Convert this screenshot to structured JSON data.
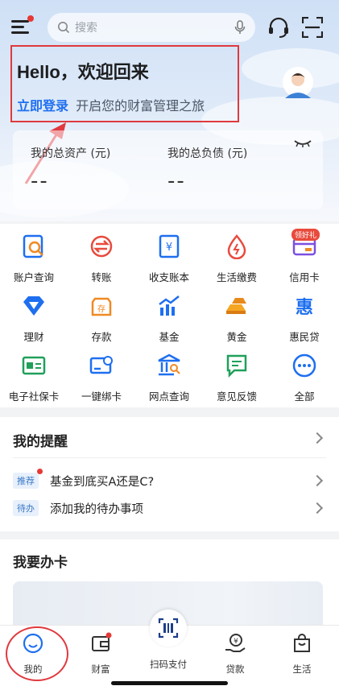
{
  "search": {
    "placeholder": "搜索"
  },
  "welcome": {
    "hello": "Hello，欢迎回来",
    "login_link": "立即登录",
    "login_sub": "开启您的财富管理之旅"
  },
  "assets": {
    "total_assets_label": "我的总资产 (元)",
    "total_assets_value": "--",
    "total_debt_label": "我的总负债 (元)",
    "total_debt_value": "--"
  },
  "grid": {
    "items": [
      {
        "label": "账户查询",
        "icon": "account-query-icon"
      },
      {
        "label": "转账",
        "icon": "transfer-icon"
      },
      {
        "label": "收支账本",
        "icon": "ledger-icon"
      },
      {
        "label": "生活缴费",
        "icon": "utility-payment-icon"
      },
      {
        "label": "信用卡",
        "icon": "credit-card-icon"
      },
      {
        "label": "理财",
        "icon": "wealth-diamond-icon"
      },
      {
        "label": "存款",
        "icon": "deposit-icon"
      },
      {
        "label": "基金",
        "icon": "fund-chart-icon"
      },
      {
        "label": "黄金",
        "icon": "gold-bar-icon"
      },
      {
        "label": "惠民贷",
        "icon": "loan-icon"
      },
      {
        "label": "电子社保卡",
        "icon": "social-security-card-icon"
      },
      {
        "label": "一键绑卡",
        "icon": "bind-card-icon"
      },
      {
        "label": "网点查询",
        "icon": "branch-query-icon"
      },
      {
        "label": "意见反馈",
        "icon": "feedback-icon"
      },
      {
        "label": "全部",
        "icon": "more-icon"
      }
    ],
    "credit_tag": "领好礼"
  },
  "reminders": {
    "title": "我的提醒",
    "rows": [
      {
        "tag": "推荐",
        "text": "基金到底买A还是C?"
      },
      {
        "tag": "待办",
        "text": "添加我的待办事项"
      }
    ]
  },
  "cards": {
    "title": "我要办卡"
  },
  "tabbar": {
    "tabs": [
      {
        "label": "我的"
      },
      {
        "label": "财富"
      },
      {
        "label": "扫码支付"
      },
      {
        "label": "贷款"
      },
      {
        "label": "生活"
      }
    ]
  },
  "colors": {
    "accent": "#1e6ff0",
    "annotation_red": "#e0393e",
    "badge_red": "#e53935"
  }
}
